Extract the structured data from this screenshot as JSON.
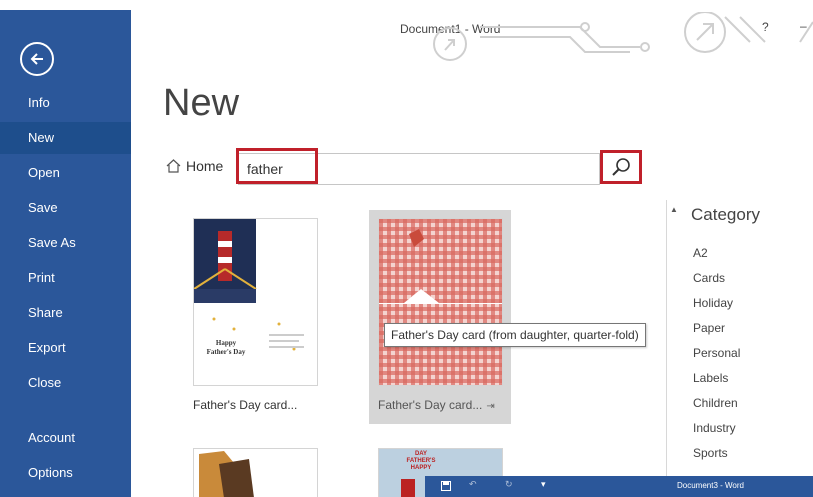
{
  "window": {
    "title": "Document1 - Word",
    "help_label": "?",
    "minimize_label": "–"
  },
  "sidebar": {
    "bg_color": "#2b579a",
    "items": [
      {
        "label": "Info"
      },
      {
        "label": "New"
      },
      {
        "label": "Open"
      },
      {
        "label": "Save"
      },
      {
        "label": "Save As"
      },
      {
        "label": "Print"
      },
      {
        "label": "Share"
      },
      {
        "label": "Export"
      },
      {
        "label": "Close"
      },
      {
        "label": "Account"
      },
      {
        "label": "Options"
      }
    ],
    "active_item": "New"
  },
  "main": {
    "page_title": "New",
    "home_label": "Home",
    "search": {
      "value": "father"
    },
    "templates": [
      {
        "caption": "Father's Day card...",
        "card_text": "Happy Father's Day"
      },
      {
        "caption": "Father's Day card...",
        "pinned": true
      },
      {
        "caption": "",
        "card_text": ""
      },
      {
        "caption": "",
        "card_text": "DAY FATHER'S HAPPY"
      }
    ],
    "tooltip": "Father's Day card (from daughter, quarter-fold)"
  },
  "category": {
    "title": "Category",
    "items": [
      "A2",
      "Cards",
      "Holiday",
      "Paper",
      "Personal",
      "Labels",
      "Children",
      "Industry",
      "Sports"
    ]
  },
  "taskbar": {
    "title": "Document3 - Word"
  },
  "colors": {
    "accent": "#2b579a",
    "highlight": "#c0202a"
  }
}
